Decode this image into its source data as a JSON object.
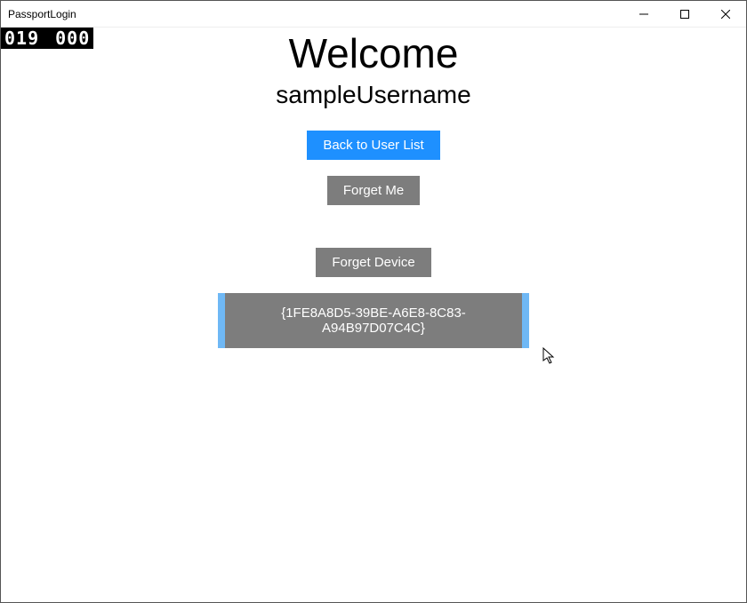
{
  "window": {
    "title": "PassportLogin"
  },
  "fps": {
    "left": "019",
    "right": "000"
  },
  "heading": "Welcome",
  "username": "sampleUsername",
  "buttons": {
    "back": "Back to User List",
    "forgetMe": "Forget Me",
    "forgetDevice": "Forget Device"
  },
  "devices": {
    "item0": "{1FE8A8D5-39BE-A6E8-8C83-A94B97D07C4C}"
  }
}
